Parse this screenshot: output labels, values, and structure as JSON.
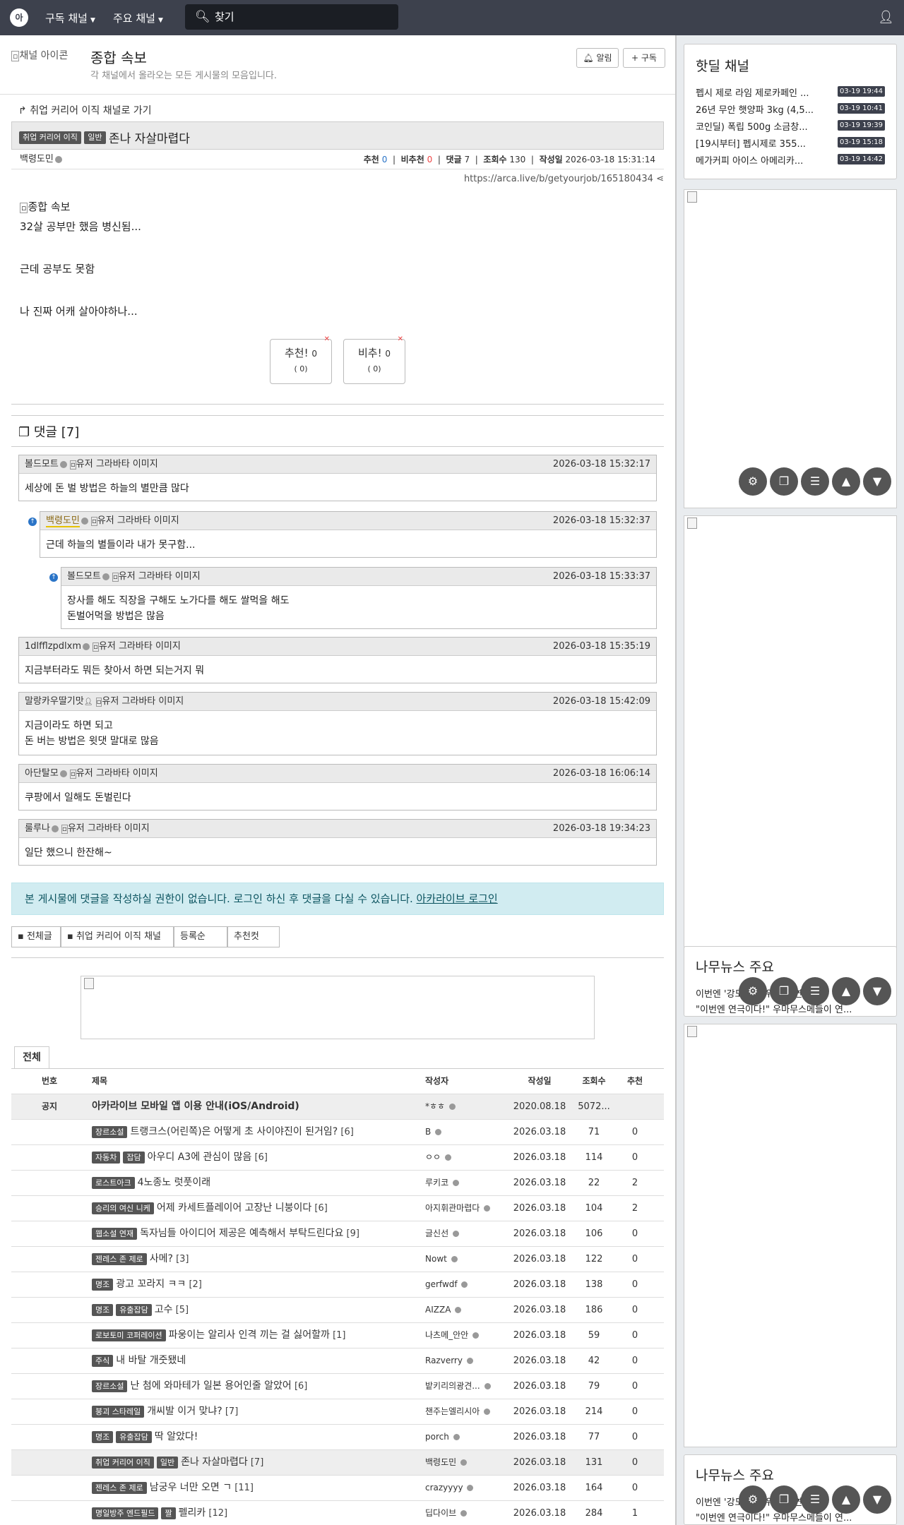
{
  "nav": {
    "logo": "아",
    "menu_subscribed": "구독 채널",
    "menu_main": "주요 채널",
    "search_placeholder": "찾기"
  },
  "channel": {
    "image_alt": "채널 아이콘",
    "title": "종합 속보",
    "desc": "각 채널에서 올라오는 모든 게시물의 모음입니다.",
    "alarm_btn": "알림",
    "subscribe_btn": "구독"
  },
  "article": {
    "go_link": "취업 커리어 이직 채널로 가기",
    "category_channel": "취업 커리어 이직",
    "category_tag": "일반",
    "title": "존나 자살마렵다",
    "author": "백령도민",
    "rec_label": "추천",
    "rec": "0",
    "unrec_label": "비추천",
    "unrec": "0",
    "comments_label": "댓글",
    "comments": "7",
    "views_label": "조회수",
    "views": "130",
    "date_label": "작성일",
    "date": "2026-03-18 15:31:14",
    "url": "https://arca.live/b/getyourjob/165180434",
    "image_alt": "종합 속보",
    "lines": [
      "32살 공부만 했음 병신됨...",
      "근데 공부도 못함",
      "나 진짜 어캐 살아야하나..."
    ],
    "vote_up_label": "추천!",
    "vote_up": "0",
    "vote_up_sub": "( 0)",
    "vote_down_label": "비추!",
    "vote_down": "0",
    "vote_down_sub": "( 0)"
  },
  "comments_section": {
    "title": "댓글 [7]",
    "avatar_alt": "유저 그라바타 이미지",
    "items": [
      {
        "author": "볼드모트",
        "date": "2026-03-18 15:32:17",
        "body": [
          "세상에 돈 벌 방법은 하늘의 별만큼 많다"
        ]
      },
      {
        "author": "백령도민",
        "date": "2026-03-18 15:32:37",
        "body": [
          "근데 하늘의 별들이라 내가 못구함..."
        ]
      },
      {
        "author": "볼드모트",
        "date": "2026-03-18 15:33:37",
        "body": [
          "장사를 해도 직장을 구해도 노가다를 해도 쌀먹을 해도",
          "돈벌어먹을 방법은 많음"
        ]
      },
      {
        "author": "1dlfflzpdlxm",
        "date": "2026-03-18 15:35:19",
        "body": [
          "지금부터라도 뭐든 찾아서 하면 되는거지 뭐"
        ]
      },
      {
        "author": "말랑카우딸기맛",
        "date": "2026-03-18 15:42:09",
        "body": [
          "지금이라도 하면 되고",
          "돈 버는 방법은 윗댓 말대로 많음"
        ]
      },
      {
        "author": "아단탈모",
        "date": "2026-03-18 16:06:14",
        "body": [
          "쿠팡에서 일해도 돈벌린다"
        ]
      },
      {
        "author": "룰루나",
        "date": "2026-03-18 19:34:23",
        "body": [
          "일단 했으니 한잔해~"
        ]
      }
    ]
  },
  "login_notice": {
    "text": "본 게시물에 댓글을 작성하실 권한이 없습니다. 로그인 하신 후 댓글을 다실 수 있습니다.",
    "link": "아카라이브 로그인"
  },
  "filter_tabs": [
    "전체글",
    "취업 커리어 이직 채널",
    "등록순",
    "추천컷"
  ],
  "list": {
    "tab": "전체",
    "headers": {
      "no": "번호",
      "title": "제목",
      "author": "작성자",
      "date": "작성일",
      "views": "조회수",
      "rec": "추천"
    },
    "rows": [
      {
        "no": "공지",
        "cats": [],
        "title": "아카라이브 모바일 앱 이용 안내(iOS/Android)",
        "count": "",
        "author": "*ㅎㅎ",
        "date": "2020.08.18",
        "views": "5072...",
        "rec": "",
        "notice": true
      },
      {
        "no": "",
        "cats": [
          "장르소설"
        ],
        "title": "트랭크스(어린쪽)은 어떻게 초 사이야진이 된거임?",
        "count": "[6]",
        "author": "B",
        "date": "2026.03.18",
        "views": "71",
        "rec": "0"
      },
      {
        "no": "",
        "cats": [
          "자동차",
          "잡담"
        ],
        "title": "아우디 A3에 관심이 많음",
        "count": "[6]",
        "author": "ㅇㅇ",
        "date": "2026.03.18",
        "views": "114",
        "rec": "0"
      },
      {
        "no": "",
        "cats": [
          "로스트아크"
        ],
        "title": "4노종노 럿풋이래",
        "count": "",
        "author": "루키코",
        "date": "2026.03.18",
        "views": "22",
        "rec": "2"
      },
      {
        "no": "",
        "cats": [
          "승리의 여신 니케"
        ],
        "title": "어제 카세트플레이어 고장난 니붕이다",
        "count": "[6]",
        "author": "아지휘관마렵다",
        "date": "2026.03.18",
        "views": "104",
        "rec": "2"
      },
      {
        "no": "",
        "cats": [
          "웹소설 연재"
        ],
        "title": "독자님들 아이디어 제공은 예측해서 부탁드린다요",
        "count": "[9]",
        "author": "글신선",
        "date": "2026.03.18",
        "views": "106",
        "rec": "0"
      },
      {
        "no": "",
        "cats": [
          "젠레스 존 제로"
        ],
        "title": "사메?",
        "count": "[3]",
        "author": "Nowt",
        "date": "2026.03.18",
        "views": "122",
        "rec": "0"
      },
      {
        "no": "",
        "cats": [
          "명조"
        ],
        "title": "광고 꼬라지 ㅋㅋ",
        "count": "[2]",
        "author": "gerfwdf",
        "date": "2026.03.18",
        "views": "138",
        "rec": "0"
      },
      {
        "no": "",
        "cats": [
          "명조",
          "유출잡담"
        ],
        "title": "고수",
        "count": "[5]",
        "author": "AIZZA",
        "date": "2026.03.18",
        "views": "186",
        "rec": "0"
      },
      {
        "no": "",
        "cats": [
          "로보토미 코퍼레이션"
        ],
        "title": "파웅이는 알리사 인격 끼는 걸 싫어할까",
        "count": "[1]",
        "author": "나츠메_안안",
        "date": "2026.03.18",
        "views": "59",
        "rec": "0"
      },
      {
        "no": "",
        "cats": [
          "주식"
        ],
        "title": "내 바탈 개줏됐네",
        "count": "",
        "author": "Razverry",
        "date": "2026.03.18",
        "views": "42",
        "rec": "0"
      },
      {
        "no": "",
        "cats": [
          "장르소설"
        ],
        "title": "난 첨에 와마테가 일본 용어인줄 알았어",
        "count": "[6]",
        "author": "밭키리의광견...",
        "date": "2026.03.18",
        "views": "79",
        "rec": "0"
      },
      {
        "no": "",
        "cats": [
          "붕괴 스타레일"
        ],
        "title": "개씨발 이거 맞냐?",
        "count": "[7]",
        "author": "챈주는엘리시아",
        "date": "2026.03.18",
        "views": "214",
        "rec": "0"
      },
      {
        "no": "",
        "cats": [
          "명조",
          "유출잡담"
        ],
        "title": "딱 알았다!",
        "count": "",
        "author": "porch",
        "date": "2026.03.18",
        "views": "77",
        "rec": "0"
      },
      {
        "no": "",
        "cats": [
          "취업 커리어 이직",
          "일반"
        ],
        "title": "존나 자살마렵다",
        "count": "[7]",
        "author": "백령도민",
        "date": "2026.03.18",
        "views": "131",
        "rec": "0",
        "current": true
      },
      {
        "no": "",
        "cats": [
          "젠레스 존 제로"
        ],
        "title": "남궁우 너만 오면 ㄱ",
        "count": "[11]",
        "author": "crazyyyy",
        "date": "2026.03.18",
        "views": "164",
        "rec": "0"
      },
      {
        "no": "",
        "cats": [
          "명일방주 엔드필드",
          "짤"
        ],
        "title": "펠리카",
        "count": "[12]",
        "author": "딥다이브",
        "date": "2026.03.18",
        "views": "284",
        "rec": "1"
      }
    ]
  },
  "sidebar": {
    "hot_title": "핫딜 채널",
    "hot_items": [
      {
        "text": "펩시 제로 라임 제로카페인 ...",
        "date": "03-19 19:44"
      },
      {
        "text": "26년 무안 햇양파 3kg (4,5...",
        "date": "03-19 10:41"
      },
      {
        "text": "코인딜) 폭립 500g 소금창...",
        "date": "03-19 19:39"
      },
      {
        "text": "[19시부터] 펩시제로 355...",
        "date": "03-19 15:18"
      },
      {
        "text": "메가커피 아이스 아메리카...",
        "date": "03-19 14:42"
      }
    ],
    "news_title": "나무뉴스 주요",
    "news_line1": "이번엔 '강도'다 누워서 공연…",
    "news_line2": "\"이번엔 연극이다!\" 우마무스메들이 연..."
  },
  "colors": {
    "nav_bg": "#3d414d",
    "accent_blue": "#2a74c7",
    "login_bg": "#d1ecf1",
    "red": "#e44444"
  }
}
